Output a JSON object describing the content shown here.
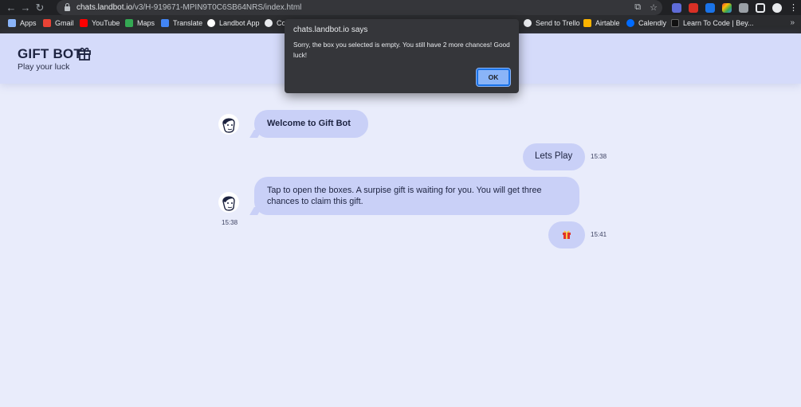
{
  "browser": {
    "url_host": "chats.landbot.io",
    "url_path": "/v3/H-919671-MPIN9T0C6SB64NRS/index.html",
    "bookmarks": [
      "Apps",
      "Gmail",
      "YouTube",
      "Maps",
      "Translate",
      "Landbot App",
      "Co",
      "Send to Trello",
      "Airtable",
      "Calendly",
      "Learn To Code | Bey..."
    ],
    "more": "»"
  },
  "header": {
    "title": "GIFT BOT",
    "subtitle": "Play your luck"
  },
  "chat": {
    "welcome": "Welcome to Gift Bot",
    "user_msg_1": "Lets Play",
    "user_time_1": "15:38",
    "bot_msg_2": "Tap to open the boxes. A surpise gift is waiting for you. You will get three chances to claim this gift.",
    "bot_time_2": "15:38",
    "user_time_2": "15:41"
  },
  "dialog": {
    "title": "chats.landbot.io says",
    "message": "Sorry, the box you selected is empty. You still have 2 more chances! Good luck!",
    "ok_label": "OK"
  },
  "colors": {
    "page_bg": "#e9ecfb",
    "header_bg": "#d5dbfa",
    "bubble": "#c9d0f7",
    "dialog_bg": "#35363a",
    "ok_button": "#8ab4f8"
  }
}
